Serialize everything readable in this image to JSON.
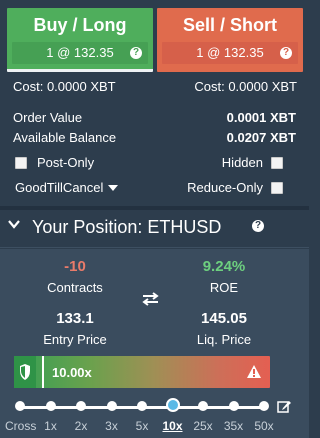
{
  "buy": {
    "title": "Buy / Long",
    "sub": "1 @ 132.35",
    "help": "?"
  },
  "sell": {
    "title": "Sell / Short",
    "sub": "1 @ 132.35",
    "help": "?"
  },
  "cost": {
    "left": "Cost: 0.0000 XBT",
    "right": "Cost: 0.0000 XBT"
  },
  "order_value": {
    "label": "Order Value",
    "value": "0.0001 XBT"
  },
  "available_balance": {
    "label": "Available Balance",
    "value": "0.0207 XBT"
  },
  "options": {
    "post_only": "Post-Only",
    "hidden": "Hidden",
    "time_in_force": "GoodTillCancel",
    "reduce_only": "Reduce-Only"
  },
  "position": {
    "title": "Your Position: ETHUSD",
    "help": "?",
    "contracts": {
      "value": "-10",
      "label": "Contracts"
    },
    "roe": {
      "value": "9.24%",
      "label": "ROE"
    },
    "entry_price": {
      "value": "133.1",
      "label": "Entry Price"
    },
    "liq_price": {
      "value": "145.05",
      "label": "Liq. Price"
    }
  },
  "leverage": {
    "value": "10.00x",
    "ticks": [
      "Cross",
      "1x",
      "2x",
      "3x",
      "5x",
      "10x",
      "25x",
      "35x",
      "50x"
    ],
    "selected_index": 5
  },
  "colors": {
    "buy": "#4fae5c",
    "sell": "#e06b4d",
    "negative": "#e97b6a",
    "positive": "#6dcf7f",
    "accent": "#5ab9e6"
  },
  "icons": [
    "help-icon",
    "chevron-down-icon",
    "swap-icon",
    "shield-icon",
    "warning-icon",
    "edit-icon",
    "caret-down-icon"
  ]
}
